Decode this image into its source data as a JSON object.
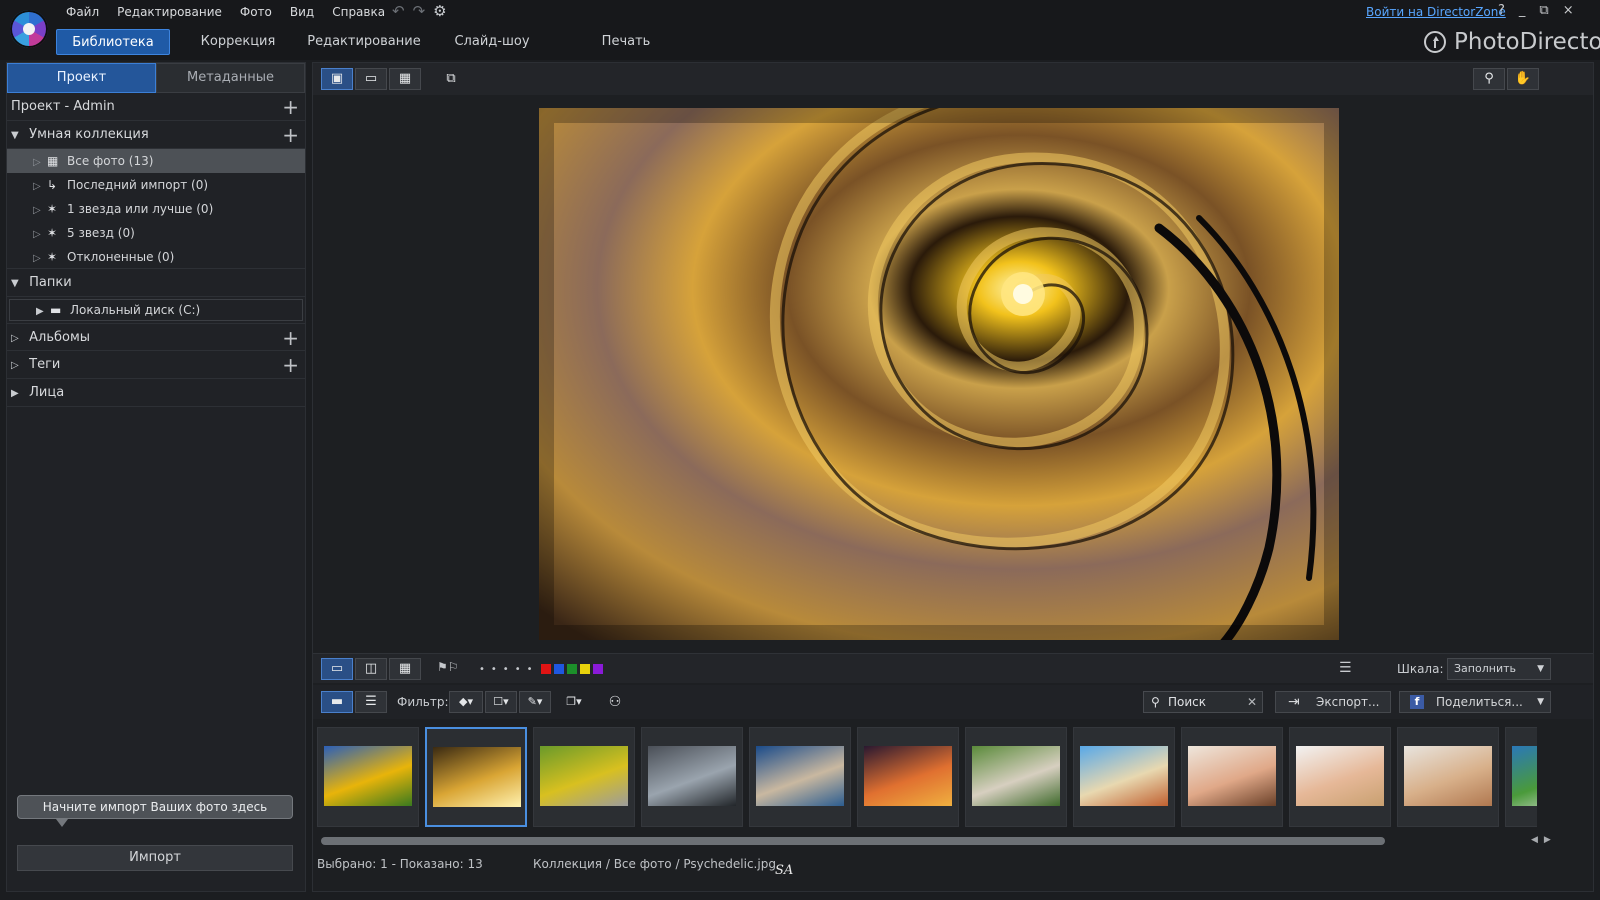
{
  "menu": [
    "Файл",
    "Редактирование",
    "Фото",
    "Вид",
    "Справка"
  ],
  "login_link": "Войти на DirectorZone",
  "window_controls": [
    "?",
    "_",
    "⧉",
    "×"
  ],
  "modes": [
    {
      "label": "Библиотека",
      "active": true
    },
    {
      "label": "Коррекция"
    },
    {
      "label": "Редактирование"
    },
    {
      "label": "Слайд-шоу"
    },
    {
      "label": "Печать"
    }
  ],
  "brand": "PhotoDirector",
  "panel_tabs": {
    "project": "Проект",
    "metadata": "Метаданные"
  },
  "project": {
    "title": "Проект - Admin"
  },
  "smart_collection": {
    "title": "Умная коллекция",
    "items": [
      {
        "label": "Все фото (13)",
        "icon": "all-photos-icon",
        "selected": true
      },
      {
        "label": "Последний импорт (0)",
        "icon": "last-import-icon"
      },
      {
        "label": "1 звезда или лучше (0)",
        "icon": "star-icon"
      },
      {
        "label": "5 звезд (0)",
        "icon": "star-icon"
      },
      {
        "label": "Отклоненные (0)",
        "icon": "reject-icon"
      }
    ]
  },
  "folders": {
    "title": "Папки",
    "items": [
      {
        "label": "Локальный диск (C:)",
        "icon": "disk-icon"
      }
    ]
  },
  "albums": {
    "title": "Альбомы"
  },
  "tags": {
    "title": "Теги"
  },
  "faces": {
    "title": "Лица"
  },
  "hint": "Начните импорт Ваших фото здесь",
  "import_label": "Импорт",
  "filter": {
    "label": "Фильтр:"
  },
  "search": {
    "value": "Поиск"
  },
  "export_label": "Экспорт...",
  "share_label": "Поделиться...",
  "scale": {
    "label": "Шкала:",
    "value": "Заполнить"
  },
  "label_colors": [
    "#e01414",
    "#1f57e0",
    "#1c8f2a",
    "#e8d20c",
    "#8a1ad8"
  ],
  "thumbnails": [
    {
      "name": "sunflower",
      "c1": "#2b5fb8",
      "c2": "#e8b40a",
      "c3": "#3a7a1e"
    },
    {
      "name": "spiral-stairs",
      "c1": "#3a2a12",
      "c2": "#d9a534",
      "c3": "#fff2b0",
      "selected": true
    },
    {
      "name": "bicycle-field",
      "c1": "#6a9a2a",
      "c2": "#d8c020",
      "c3": "#9c9c9c"
    },
    {
      "name": "boat-lake",
      "c1": "#4a4f57",
      "c2": "#9aa4ae",
      "c3": "#22262a"
    },
    {
      "name": "mountain-lake",
      "c1": "#1a4b8a",
      "c2": "#c9b8a0",
      "c3": "#2c5d90"
    },
    {
      "name": "sunset-clouds",
      "c1": "#2a1830",
      "c2": "#e07030",
      "c3": "#f0b040"
    },
    {
      "name": "cat-grass",
      "c1": "#5a8a3a",
      "c2": "#d7cfc0",
      "c3": "#3f6a2c"
    },
    {
      "name": "beach-couple",
      "c1": "#58a8e8",
      "c2": "#e8d8b0",
      "c3": "#c06030"
    },
    {
      "name": "woman-smiling",
      "c1": "#eee6dc",
      "c2": "#e0a888",
      "c3": "#6a4028"
    },
    {
      "name": "woman-laughing",
      "c1": "#f2f2f2",
      "c2": "#e6b898",
      "c3": "#c8a070"
    },
    {
      "name": "woman-blonde",
      "c1": "#e8e4de",
      "c2": "#d8b08a",
      "c3": "#b07850"
    },
    {
      "name": "landscape-partial",
      "c1": "#2a78b8",
      "c2": "#4a9a3a",
      "c3": "#e0e0e0"
    }
  ],
  "status": {
    "selection": "Выбрано: 1 - Показано: 13",
    "path": "Коллекция / Все фото / Psychedelic.jpg"
  },
  "signature": "SA"
}
